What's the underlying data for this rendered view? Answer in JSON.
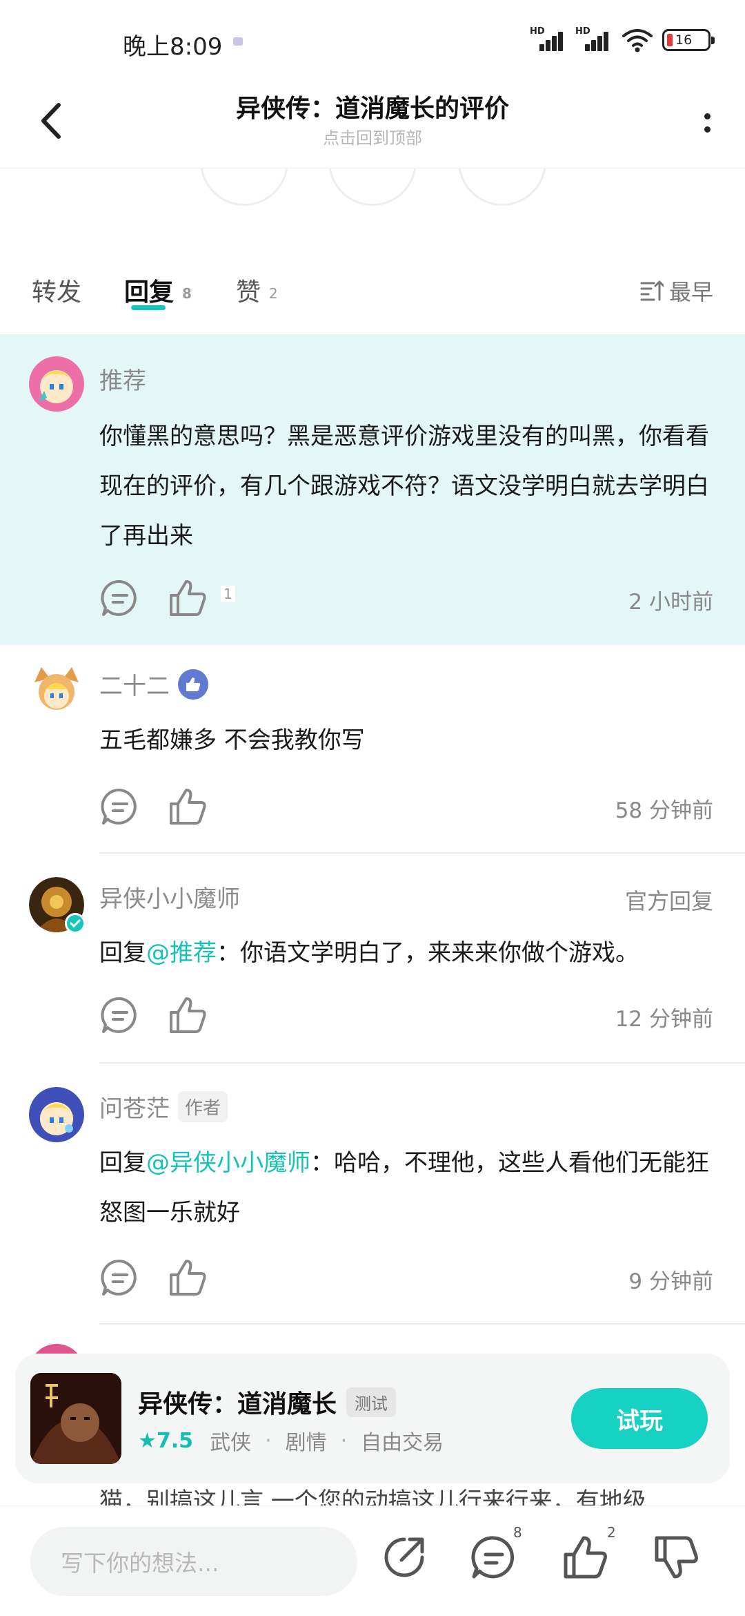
{
  "status_bar": {
    "time": "晚上8:09",
    "battery": "16"
  },
  "header": {
    "title": "异侠传：道消魔长的评价",
    "subtitle": "点击回到顶部"
  },
  "tabs": [
    {
      "label": "转发",
      "count": ""
    },
    {
      "label": "回复",
      "count": "8"
    },
    {
      "label": "赞",
      "count": "2"
    }
  ],
  "sort": {
    "label": "最早"
  },
  "comments": [
    {
      "name": "推荐",
      "text": "你懂黑的意思吗？黑是恶意评价游戏里没有的叫黑，你看看现在的评价，有几个跟游戏不符？语文没学明白就去学明白了再出来",
      "likes": "1",
      "time": "2 小时前"
    },
    {
      "name": "二十二",
      "text": "五毛都嫌多 不会我教你写",
      "time": "58 分钟前"
    },
    {
      "name": "异侠小小魔师",
      "official": "官方回复",
      "reply_prefix": "回复",
      "mention": "@推荐",
      "text": "：你语文学明白了，来来来你做个游戏。",
      "time": "12 分钟前"
    },
    {
      "name": "问苍茫",
      "tag": "作者",
      "reply_prefix": "回复",
      "mention": "@异侠小小魔师",
      "text": "：哈哈，不理他，这些人看他们无能狂怒图一乐就好",
      "time": "9 分钟前"
    }
  ],
  "game": {
    "name": "异侠传：道消魔长",
    "tag": "测试",
    "score": "7.5",
    "genres": [
      "武侠",
      "剧情",
      "自由交易"
    ],
    "play_label": "试玩"
  },
  "bottom_bar": {
    "input_placeholder": "写下你的想法...",
    "comment_count": "8",
    "like_count": "2"
  },
  "peek_text": "猫，别搞这儿言 一个您的动搞这儿行来行来，有地级"
}
